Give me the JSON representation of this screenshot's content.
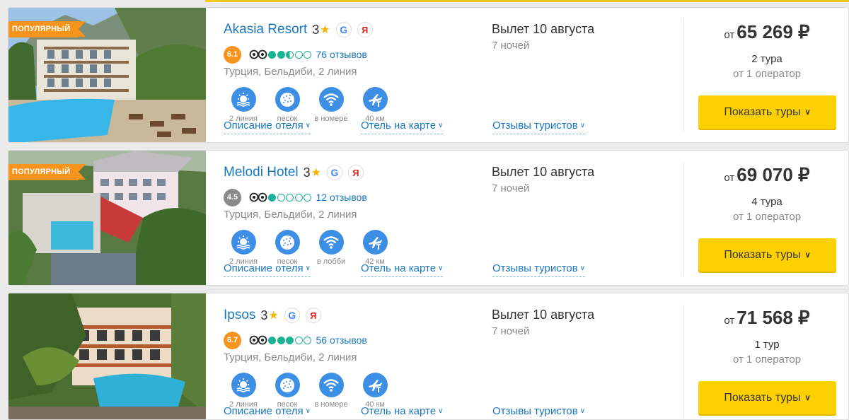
{
  "colors": {
    "accent": "#f7c919",
    "link": "#1a78c2",
    "badge": "#f7941d",
    "button": "#ffd000",
    "amenity": "#3d8fe6",
    "tripadvisor": "#1ab394"
  },
  "hotels": [
    {
      "badge": "ПОПУЛЯРНЫЙ",
      "name": "Akasia Resort",
      "stars": "3",
      "score": "6.1",
      "score_color": "orange",
      "tripadvisor_bubbles": 2.5,
      "reviews": "76 отзывов",
      "location": "Турция, Бельдиби, 2 линия",
      "amenities": [
        {
          "icon": "beach-line-icon",
          "label": "2 линия"
        },
        {
          "icon": "sand-icon",
          "label": "песок"
        },
        {
          "icon": "wifi-icon",
          "label": "в номере"
        },
        {
          "icon": "airport-icon",
          "label": "40 км"
        }
      ],
      "links": {
        "description": "Описание отеля",
        "map": "Отель на карте",
        "reviews": "Отзывы туристов"
      },
      "departure": "Вылет 10 августа",
      "nights": "7 ночей",
      "price_from": "от",
      "price": "65 269 ₽",
      "tours": "2 тура",
      "operators": "от 1 оператор",
      "button": "Показать туры"
    },
    {
      "badge": "ПОПУЛЯРНЫЙ",
      "name": "Melodi Hotel",
      "stars": "3",
      "score": "4.5",
      "score_color": "grey",
      "tripadvisor_bubbles": 1,
      "reviews": "12 отзывов",
      "location": "Турция, Бельдиби, 2 линия",
      "amenities": [
        {
          "icon": "beach-line-icon",
          "label": "2 линия"
        },
        {
          "icon": "sand-icon",
          "label": "песок"
        },
        {
          "icon": "wifi-icon",
          "label": "в лобби"
        },
        {
          "icon": "airport-icon",
          "label": "42 км"
        }
      ],
      "links": {
        "description": "Описание отеля",
        "map": "Отель на карте",
        "reviews": "Отзывы туристов"
      },
      "departure": "Вылет 10 августа",
      "nights": "7 ночей",
      "price_from": "от",
      "price": "69 070 ₽",
      "tours": "4 тура",
      "operators": "от 1 оператор",
      "button": "Показать туры"
    },
    {
      "badge": "",
      "name": "Ipsos",
      "stars": "3",
      "score": "6.7",
      "score_color": "orange",
      "tripadvisor_bubbles": 3,
      "reviews": "56 отзывов",
      "location": "Турция, Бельдиби, 2 линия",
      "amenities": [
        {
          "icon": "beach-line-icon",
          "label": "2 линия"
        },
        {
          "icon": "sand-icon",
          "label": "песок"
        },
        {
          "icon": "wifi-icon",
          "label": "в номере"
        },
        {
          "icon": "airport-icon",
          "label": "40 км"
        }
      ],
      "links": {
        "description": "Описание отеля",
        "map": "Отель на карте",
        "reviews": "Отзывы туристов"
      },
      "departure": "Вылет 10 августа",
      "nights": "7 ночей",
      "price_from": "от",
      "price": "71 568 ₽",
      "tours": "1 тур",
      "operators": "от 1 оператор",
      "button": "Показать туры"
    }
  ]
}
